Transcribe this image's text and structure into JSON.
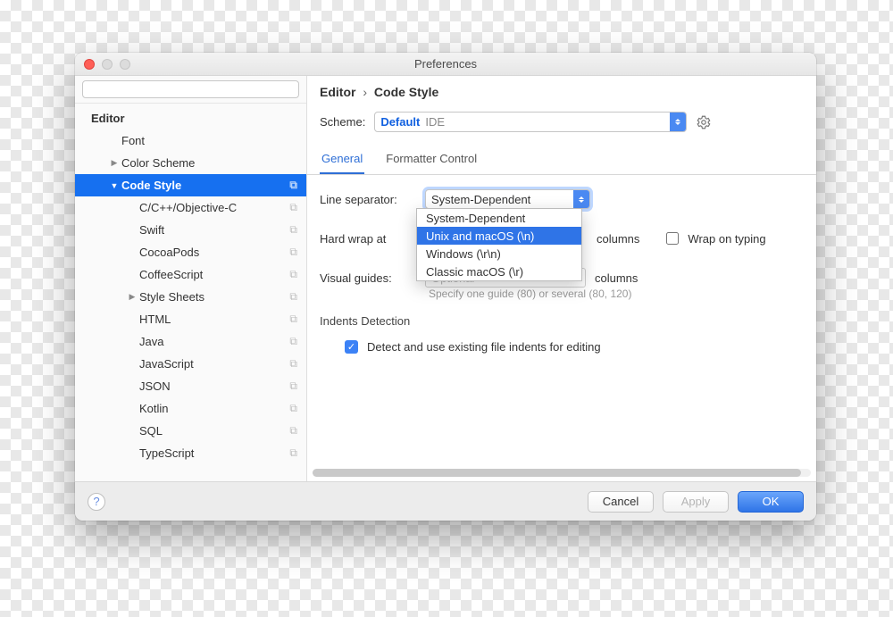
{
  "window": {
    "title": "Preferences"
  },
  "search": {
    "placeholder": ""
  },
  "tree": {
    "root": "Editor",
    "items": [
      {
        "label": "Font",
        "arrow": "",
        "lvl": 2,
        "copy": false
      },
      {
        "label": "Color Scheme",
        "arrow": "▶",
        "lvl": 2,
        "copy": false
      },
      {
        "label": "Code Style",
        "arrow": "▼",
        "lvl": 2,
        "copy": true,
        "selected": true
      },
      {
        "label": "C/C++/Objective-C",
        "arrow": "",
        "lvl": 3,
        "copy": true
      },
      {
        "label": "Swift",
        "arrow": "",
        "lvl": 3,
        "copy": true
      },
      {
        "label": "CocoaPods",
        "arrow": "",
        "lvl": 3,
        "copy": true
      },
      {
        "label": "CoffeeScript",
        "arrow": "",
        "lvl": 3,
        "copy": true
      },
      {
        "label": "Style Sheets",
        "arrow": "▶",
        "lvl": 3,
        "copy": true
      },
      {
        "label": "HTML",
        "arrow": "",
        "lvl": 3,
        "copy": true
      },
      {
        "label": "Java",
        "arrow": "",
        "lvl": 3,
        "copy": true
      },
      {
        "label": "JavaScript",
        "arrow": "",
        "lvl": 3,
        "copy": true
      },
      {
        "label": "JSON",
        "arrow": "",
        "lvl": 3,
        "copy": true
      },
      {
        "label": "Kotlin",
        "arrow": "",
        "lvl": 3,
        "copy": true
      },
      {
        "label": "SQL",
        "arrow": "",
        "lvl": 3,
        "copy": true
      },
      {
        "label": "TypeScript",
        "arrow": "",
        "lvl": 3,
        "copy": true
      }
    ]
  },
  "breadcrumb": {
    "a": "Editor",
    "sep": "›",
    "b": "Code Style"
  },
  "scheme": {
    "label": "Scheme:",
    "value": "Default",
    "scope": "IDE"
  },
  "tabs": {
    "general": "General",
    "formatter": "Formatter Control"
  },
  "lineSeparator": {
    "label": "Line separator:",
    "selected": "System-Dependent",
    "options": [
      "System-Dependent",
      "Unix and macOS (\\n)",
      "Windows (\\r\\n)",
      "Classic macOS (\\r)"
    ],
    "highlightIndex": 1
  },
  "hardWrap": {
    "label": "Hard wrap at",
    "unit": "columns",
    "wrapOnTyping": "Wrap on typing"
  },
  "visualGuides": {
    "label": "Visual guides:",
    "placeholder": "Optional",
    "unit": "columns",
    "hint": "Specify one guide (80) or several (80, 120)"
  },
  "indents": {
    "section": "Indents Detection",
    "detect": "Detect and use existing file indents for editing"
  },
  "buttons": {
    "cancel": "Cancel",
    "apply": "Apply",
    "ok": "OK"
  }
}
